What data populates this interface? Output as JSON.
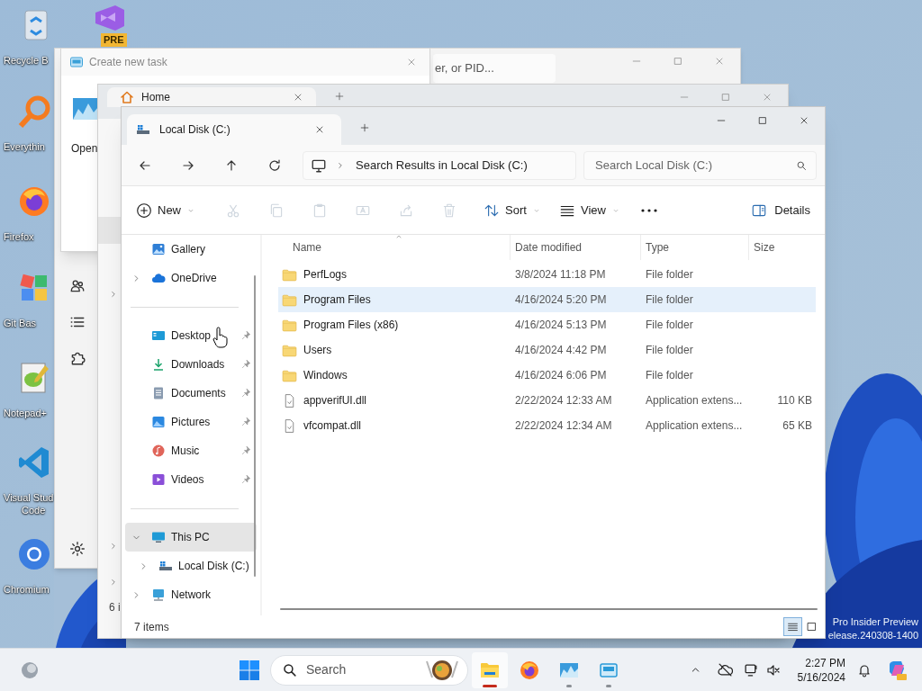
{
  "desktop": {
    "icons": [
      {
        "kind": "recycle-bin",
        "lines": [
          "Recycle B"
        ]
      },
      {
        "kind": "vs-preview",
        "badge": "PRE"
      },
      {
        "kind": "everything",
        "lines": [
          "Everythin"
        ]
      },
      {
        "kind": "firefox",
        "lines": [
          "Firefox"
        ]
      },
      {
        "kind": "git-bash",
        "lines": [
          "Git Bas"
        ]
      },
      {
        "kind": "notepad",
        "lines": [
          "Notepad+"
        ]
      },
      {
        "kind": "vscode",
        "lines": [
          "Visual Stud",
          "Code"
        ]
      },
      {
        "kind": "chromium",
        "lines": [
          "Chromium"
        ]
      }
    ],
    "build_info": [
      "Pro Insider Preview",
      "elease.240308-1400"
    ]
  },
  "task_manager": {
    "search_placeholder": "er, or PID..."
  },
  "run_dialog": {
    "title": "Create new task",
    "label": "Open"
  },
  "home_window": {
    "tab": "Home",
    "status": "6 i"
  },
  "explorer": {
    "tab": "Local Disk (C:)",
    "address": "Search Results in Local Disk (C:)",
    "search_placeholder": "Search Local Disk (C:)",
    "toolbar": [
      {
        "kind": "new",
        "label": "New",
        "disabled": false
      },
      {
        "kind": "cut",
        "disabled": true
      },
      {
        "kind": "copy",
        "disabled": true
      },
      {
        "kind": "paste",
        "disabled": true
      },
      {
        "kind": "rename",
        "disabled": true
      },
      {
        "kind": "share",
        "disabled": true
      },
      {
        "kind": "delete",
        "disabled": true
      },
      {
        "kind": "sort",
        "label": "Sort",
        "disabled": false
      },
      {
        "kind": "view",
        "label": "View",
        "disabled": false
      },
      {
        "kind": "more",
        "disabled": false
      }
    ],
    "details_label": "Details",
    "nav_sections": [
      {
        "items": [
          {
            "kind": "gallery",
            "label": "Gallery",
            "selected": false
          },
          {
            "kind": "onedrive",
            "label": "OneDrive",
            "selected": false,
            "expanded": false
          }
        ]
      },
      {
        "items": [
          {
            "kind": "desktop",
            "label": "Desktop",
            "selected": false,
            "pinned": true
          },
          {
            "kind": "downloads",
            "label": "Downloads",
            "selected": false,
            "pinned": true
          },
          {
            "kind": "documents",
            "label": "Documents",
            "selected": false,
            "pinned": true
          },
          {
            "kind": "pictures",
            "label": "Pictures",
            "selected": false,
            "pinned": true
          },
          {
            "kind": "music",
            "label": "Music",
            "selected": false,
            "pinned": true
          },
          {
            "kind": "videos",
            "label": "Videos",
            "selected": false,
            "pinned": true
          }
        ]
      },
      {
        "items": [
          {
            "kind": "pc",
            "label": "This PC",
            "selected": true,
            "expanded": true,
            "children": [
              {
                "kind": "drive",
                "label": "Local Disk (C:)",
                "selected": false,
                "expanded": false
              }
            ]
          },
          {
            "kind": "network",
            "label": "Network",
            "selected": false,
            "expanded": false
          }
        ]
      }
    ],
    "columns": [
      {
        "label": "Name",
        "sorted": true
      },
      {
        "label": "Date modified",
        "sorted": false
      },
      {
        "label": "Type",
        "sorted": false
      },
      {
        "label": "Size",
        "sorted": false
      }
    ],
    "rows": [
      {
        "kind": "folder",
        "name": "PerfLogs",
        "date": "3/8/2024 11:18 PM",
        "type": "File folder",
        "selected": false
      },
      {
        "kind": "folder",
        "name": "Program Files",
        "date": "4/16/2024 5:20 PM",
        "type": "File folder",
        "selected": true
      },
      {
        "kind": "folder",
        "name": "Program Files (x86)",
        "date": "4/16/2024 5:13 PM",
        "type": "File folder",
        "selected": false
      },
      {
        "kind": "folder",
        "name": "Users",
        "date": "4/16/2024 4:42 PM",
        "type": "File folder",
        "selected": false
      },
      {
        "kind": "folder",
        "name": "Windows",
        "date": "4/16/2024 6:06 PM",
        "type": "File folder",
        "selected": false
      },
      {
        "kind": "file",
        "name": "appverifUI.dll",
        "date": "2/22/2024 12:33 AM",
        "type": "Application extens...",
        "size": "110 KB",
        "selected": false
      },
      {
        "kind": "file",
        "name": "vfcompat.dll",
        "date": "2/22/2024 12:34 AM",
        "type": "Application extens...",
        "size": "65 KB",
        "selected": false
      }
    ],
    "status": "7 items",
    "view_modes": [
      {
        "kind": "details",
        "selected": true
      },
      {
        "kind": "tiles",
        "selected": false
      }
    ]
  },
  "taskbar": {
    "search_placeholder": "Search",
    "apps": [
      {
        "kind": "file-explorer",
        "running": true,
        "active": true
      },
      {
        "kind": "firefox",
        "running": false,
        "active": false
      },
      {
        "kind": "task-manager",
        "running": true,
        "active": false
      },
      {
        "kind": "run-dialog",
        "running": true,
        "active": false
      }
    ],
    "time": "2:27 PM",
    "date": "5/16/2024"
  }
}
